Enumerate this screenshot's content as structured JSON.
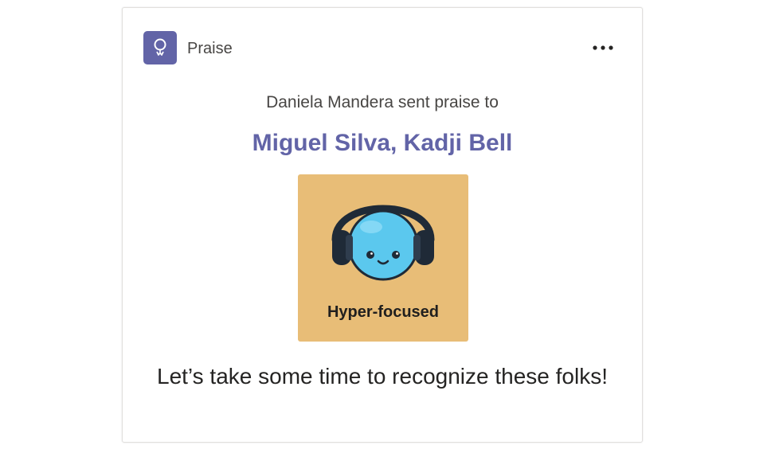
{
  "app": {
    "name": "Praise",
    "icon": "praise-ribbon-icon",
    "icon_bg": "#6264a7"
  },
  "card": {
    "more_options_icon": "more-options-icon",
    "sender_line": "Daniela Mandera sent praise to",
    "recipients": "Miguel Silva, Kadji Bell",
    "recipients_color": "#6264a7",
    "badge": {
      "icon": "headphones-face-icon",
      "label": "Hyper-focused",
      "background": "#e8bd77"
    },
    "message": "Let’s take some time to recognize these folks!"
  }
}
